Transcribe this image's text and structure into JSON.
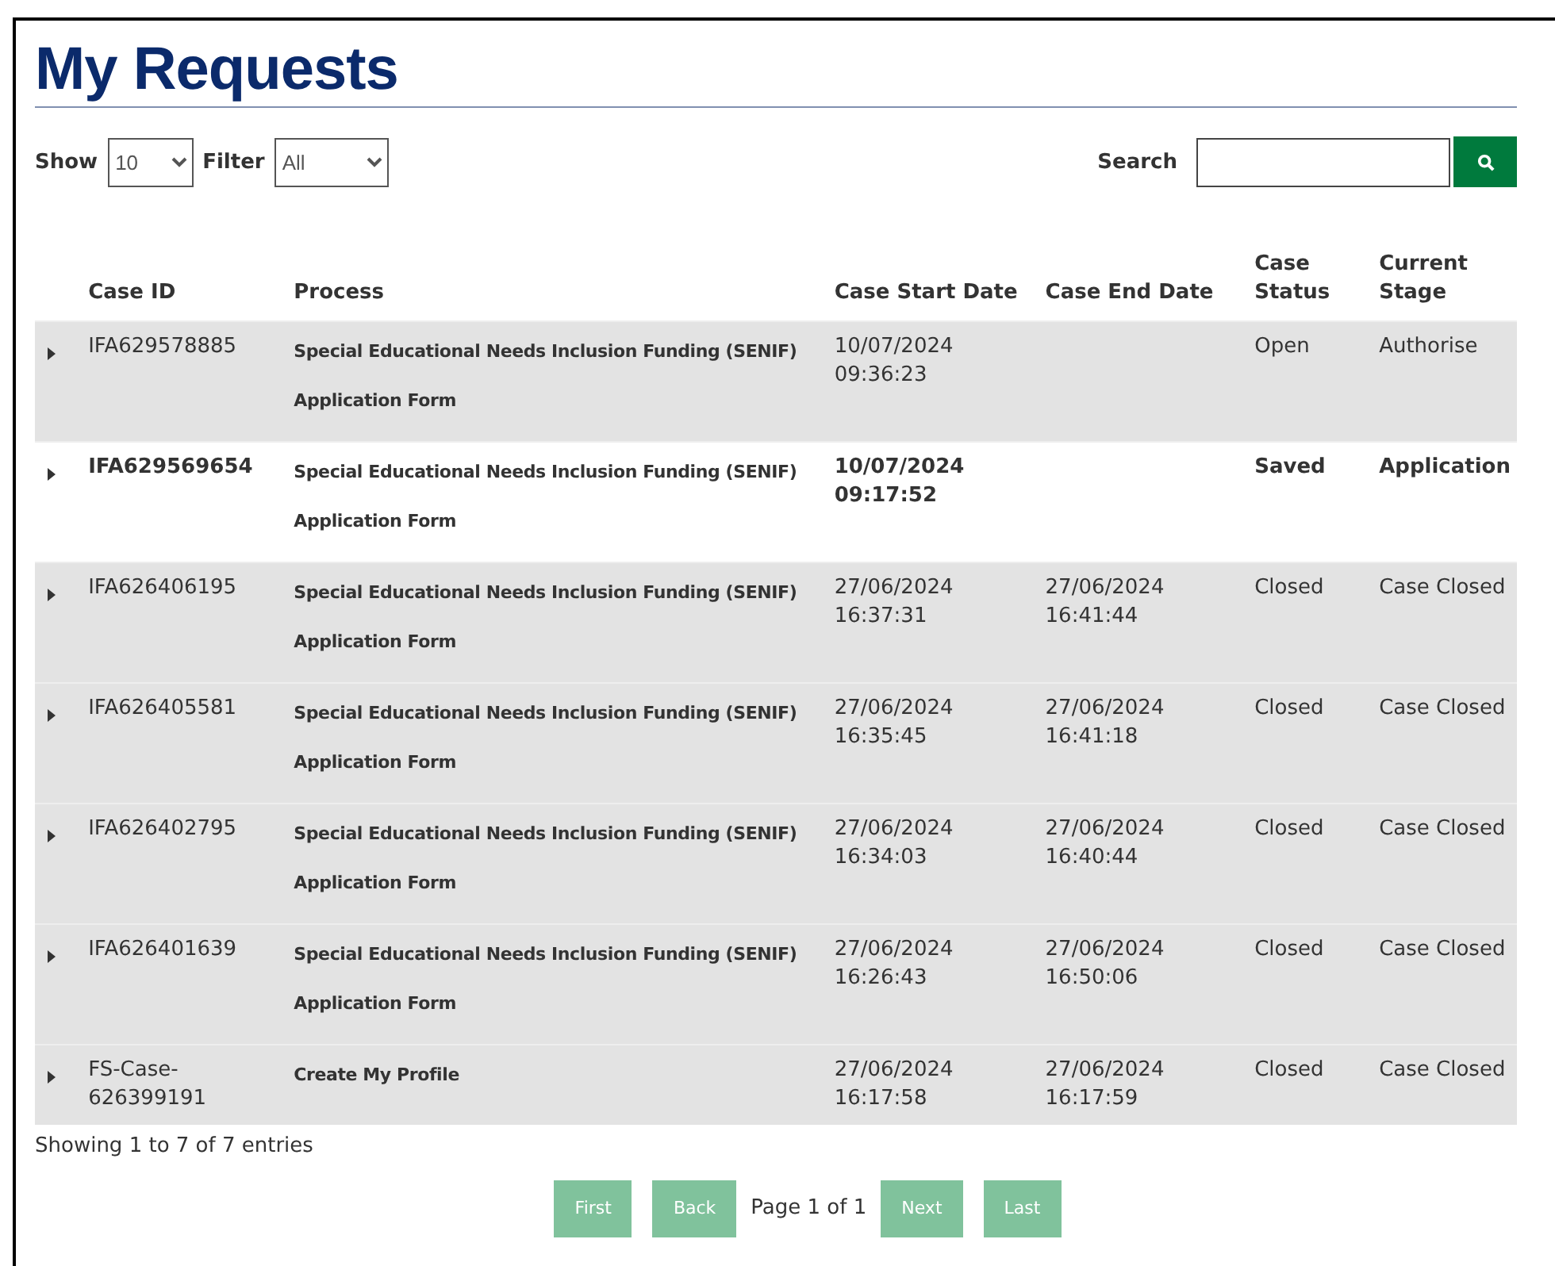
{
  "page": {
    "title": "My Requests"
  },
  "controls": {
    "show_label": "Show",
    "show_value": "10",
    "filter_label": "Filter",
    "filter_value": "All",
    "search_label": "Search"
  },
  "table": {
    "columns": [
      "Case ID",
      "Process",
      "Case Start Date",
      "Case End Date",
      "Case Status",
      "Current Stage"
    ],
    "rows": [
      {
        "case_id": "IFA629578885",
        "process": [
          "Special Educational Needs Inclusion Funding (SENIF)",
          "Application Form"
        ],
        "start": [
          "10/07/2024",
          "09:36:23"
        ],
        "end": [],
        "status": "Open",
        "stage": "Authorise",
        "unread": false
      },
      {
        "case_id": "IFA629569654",
        "process": [
          "Special Educational Needs Inclusion Funding (SENIF)",
          "Application Form"
        ],
        "start": [
          "10/07/2024",
          "09:17:52"
        ],
        "end": [],
        "status": "Saved",
        "stage": "Application",
        "unread": true
      },
      {
        "case_id": "IFA626406195",
        "process": [
          "Special Educational Needs Inclusion Funding (SENIF)",
          "Application Form"
        ],
        "start": [
          "27/06/2024",
          "16:37:31"
        ],
        "end": [
          "27/06/2024",
          "16:41:44"
        ],
        "status": "Closed",
        "stage": "Case Closed",
        "unread": false
      },
      {
        "case_id": "IFA626405581",
        "process": [
          "Special Educational Needs Inclusion Funding (SENIF)",
          "Application Form"
        ],
        "start": [
          "27/06/2024",
          "16:35:45"
        ],
        "end": [
          "27/06/2024",
          "16:41:18"
        ],
        "status": "Closed",
        "stage": "Case Closed",
        "unread": false
      },
      {
        "case_id": "IFA626402795",
        "process": [
          "Special Educational Needs Inclusion Funding (SENIF)",
          "Application Form"
        ],
        "start": [
          "27/06/2024",
          "16:34:03"
        ],
        "end": [
          "27/06/2024",
          "16:40:44"
        ],
        "status": "Closed",
        "stage": "Case Closed",
        "unread": false
      },
      {
        "case_id": "IFA626401639",
        "process": [
          "Special Educational Needs Inclusion Funding (SENIF)",
          "Application Form"
        ],
        "start": [
          "27/06/2024",
          "16:26:43"
        ],
        "end": [
          "27/06/2024",
          "16:50:06"
        ],
        "status": "Closed",
        "stage": "Case Closed",
        "unread": false
      },
      {
        "case_id": "FS-Case-626399191",
        "process": [
          "Create My Profile"
        ],
        "start": [
          "27/06/2024",
          "16:17:58"
        ],
        "end": [
          "27/06/2024",
          "16:17:59"
        ],
        "status": "Closed",
        "stage": "Case Closed",
        "unread": false
      }
    ]
  },
  "summary": "Showing 1 to 7 of 7 entries",
  "pagination": {
    "buttons": [
      {
        "label": "First",
        "disabled": true
      },
      {
        "label": "Back",
        "disabled": true
      },
      {
        "label": "Next",
        "disabled": true
      },
      {
        "label": "Last",
        "disabled": true
      }
    ],
    "page_text": "Page 1 of 1"
  }
}
